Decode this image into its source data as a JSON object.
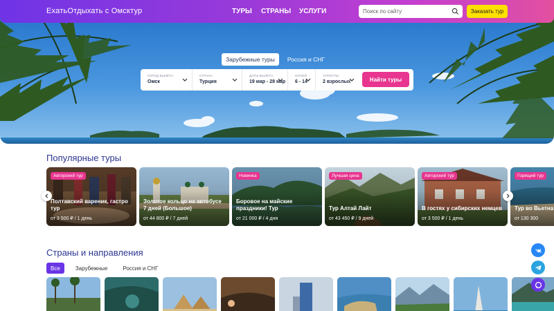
{
  "header": {
    "logo": "ЕхатьОтдыхать с Омсктур",
    "nav": [
      "ТУРЫ",
      "СТРАНЫ",
      "УСЛУГИ"
    ],
    "search_placeholder": "Поиск по сайту",
    "order_button": "Заказать тур"
  },
  "hero": {
    "tabs": [
      {
        "label": "Зарубежные туры",
        "active": true
      },
      {
        "label": "Россия и СНГ",
        "active": false
      }
    ],
    "form": {
      "fields": [
        {
          "label": "Город вылета",
          "value": "Омск"
        },
        {
          "label": "Страна",
          "value": "Турция"
        },
        {
          "label": "Даты вылета",
          "value": "19 мар - 28 мар"
        },
        {
          "label": "Ночей",
          "value": "6 - 14"
        },
        {
          "label": "Туристы",
          "value": "2 взрослых"
        }
      ],
      "submit": "Найти туры"
    }
  },
  "popular": {
    "title": "Популярные туры",
    "cards": [
      {
        "badge": "Авторский тур",
        "name": "Полтавский вареник, гастро тур",
        "price": "от 3 500 ₽ / 1 день"
      },
      {
        "badge": "",
        "name": "Золотое кольцо на автобусе 7 дней (Большое)",
        "price": "от 44 800 ₽ / 7 дней"
      },
      {
        "badge": "Новинка",
        "name": "Боровое на майские праздники! Тур",
        "price": "от 21 000 ₽ / 4 дня"
      },
      {
        "badge": "Лучшая цена",
        "name": "Тур Алтай Лайт",
        "price": "от 43 450 ₽ / 9 дней"
      },
      {
        "badge": "Авторский тур",
        "name": "В гостях у сибирских немцев",
        "price": "от 3 500 ₽ / 1 день"
      },
      {
        "badge": "Горящий тур",
        "name": "Тур во Вьетна 5*",
        "price": "от 130 300"
      }
    ]
  },
  "countries": {
    "title": "Страны и направления",
    "filters": [
      {
        "label": "Все",
        "active": true
      },
      {
        "label": "Зарубежные",
        "active": false
      },
      {
        "label": "Россия и СНГ",
        "active": false
      }
    ]
  },
  "colors": {
    "accent": "#e8358f",
    "brand_purple": "#6a35e6",
    "order_yellow": "#ffe100",
    "title_blue": "#2b3590"
  },
  "icons": [
    "search-icon",
    "chevron-down-icon",
    "chevron-left-icon",
    "chevron-right-icon",
    "vk-icon",
    "telegram-icon",
    "chat-icon"
  ]
}
